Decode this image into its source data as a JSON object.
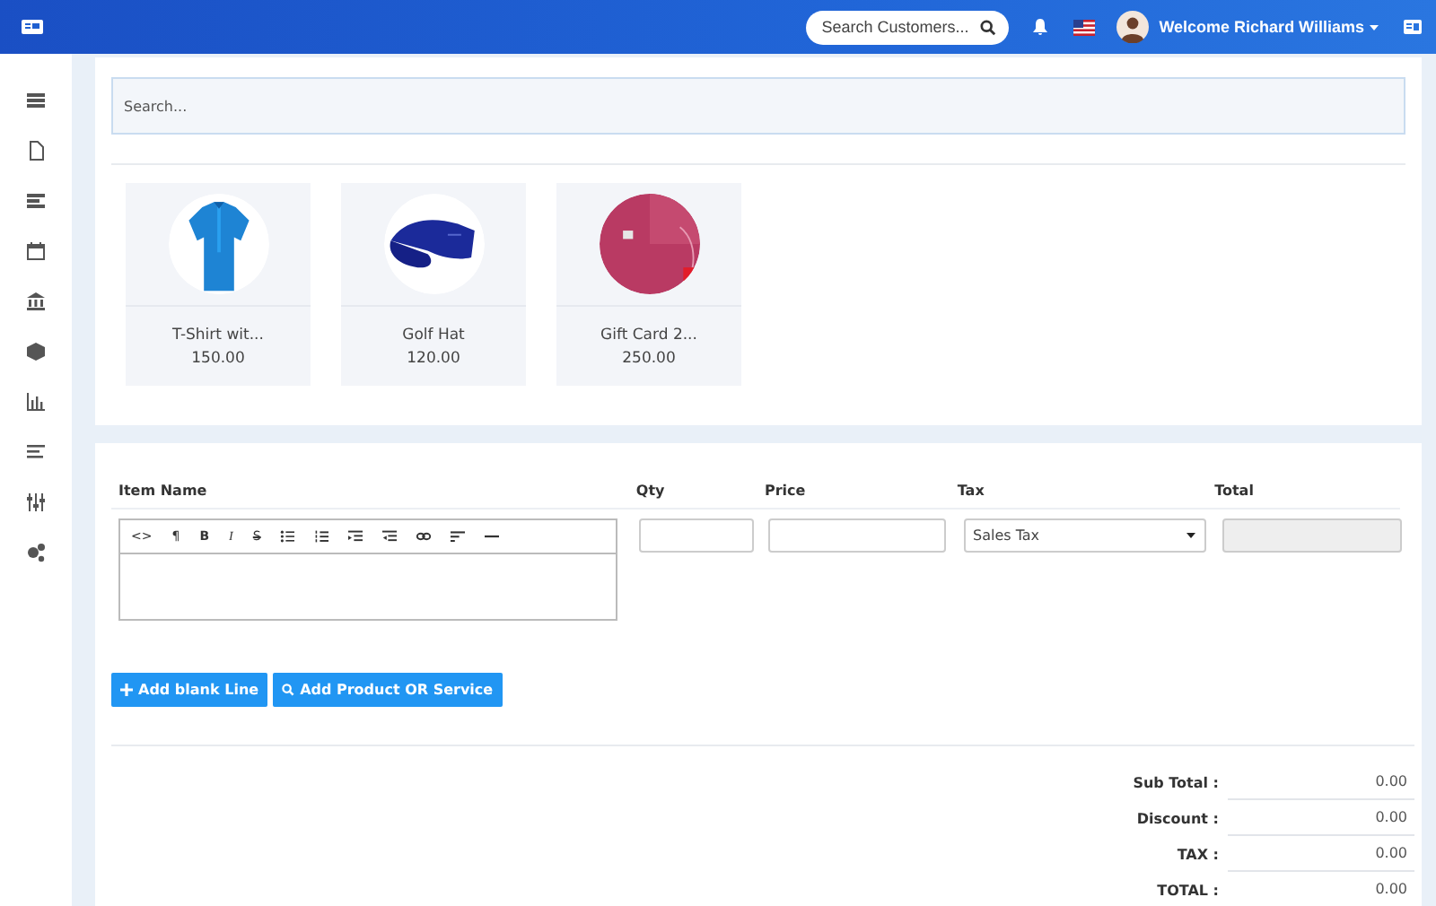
{
  "topbar": {
    "search": {
      "placeholder": "Search Customers..."
    },
    "user": {
      "greeting": "Welcome Richard Williams"
    }
  },
  "search": {
    "placeholder": "Search..."
  },
  "products": [
    {
      "name": "T-Shirt wit...",
      "price": "150.00",
      "kind": "shirt"
    },
    {
      "name": "Golf Hat",
      "price": "120.00",
      "kind": "hat"
    },
    {
      "name": "Gift Card 2...",
      "price": "250.00",
      "kind": "card"
    }
  ],
  "items_table": {
    "columns": [
      "Item Name",
      "Qty",
      "Price",
      "Tax",
      "Total"
    ],
    "editor_toolbar": [
      {
        "kind": "text",
        "label": "<>"
      },
      {
        "kind": "text",
        "label": "¶"
      },
      {
        "kind": "bold",
        "label": "B"
      },
      {
        "kind": "italic",
        "label": "I"
      },
      {
        "kind": "strike",
        "label": "S"
      },
      {
        "kind": "ul"
      },
      {
        "kind": "ol"
      },
      {
        "kind": "outdent"
      },
      {
        "kind": "indent"
      },
      {
        "kind": "link"
      },
      {
        "kind": "align"
      },
      {
        "kind": "hr"
      }
    ],
    "tax": {
      "value": "Sales Tax"
    }
  },
  "buttons": [
    {
      "kind": "plus",
      "label": "Add blank Line"
    },
    {
      "kind": "search",
      "label": "Add Product OR Service"
    }
  ],
  "totals": [
    {
      "label": "Sub Total :",
      "value": "0.00"
    },
    {
      "label": "Discount :",
      "value": "0.00"
    },
    {
      "label": "TAX :",
      "value": "0.00"
    },
    {
      "label": "TOTAL :",
      "value": "0.00"
    }
  ]
}
